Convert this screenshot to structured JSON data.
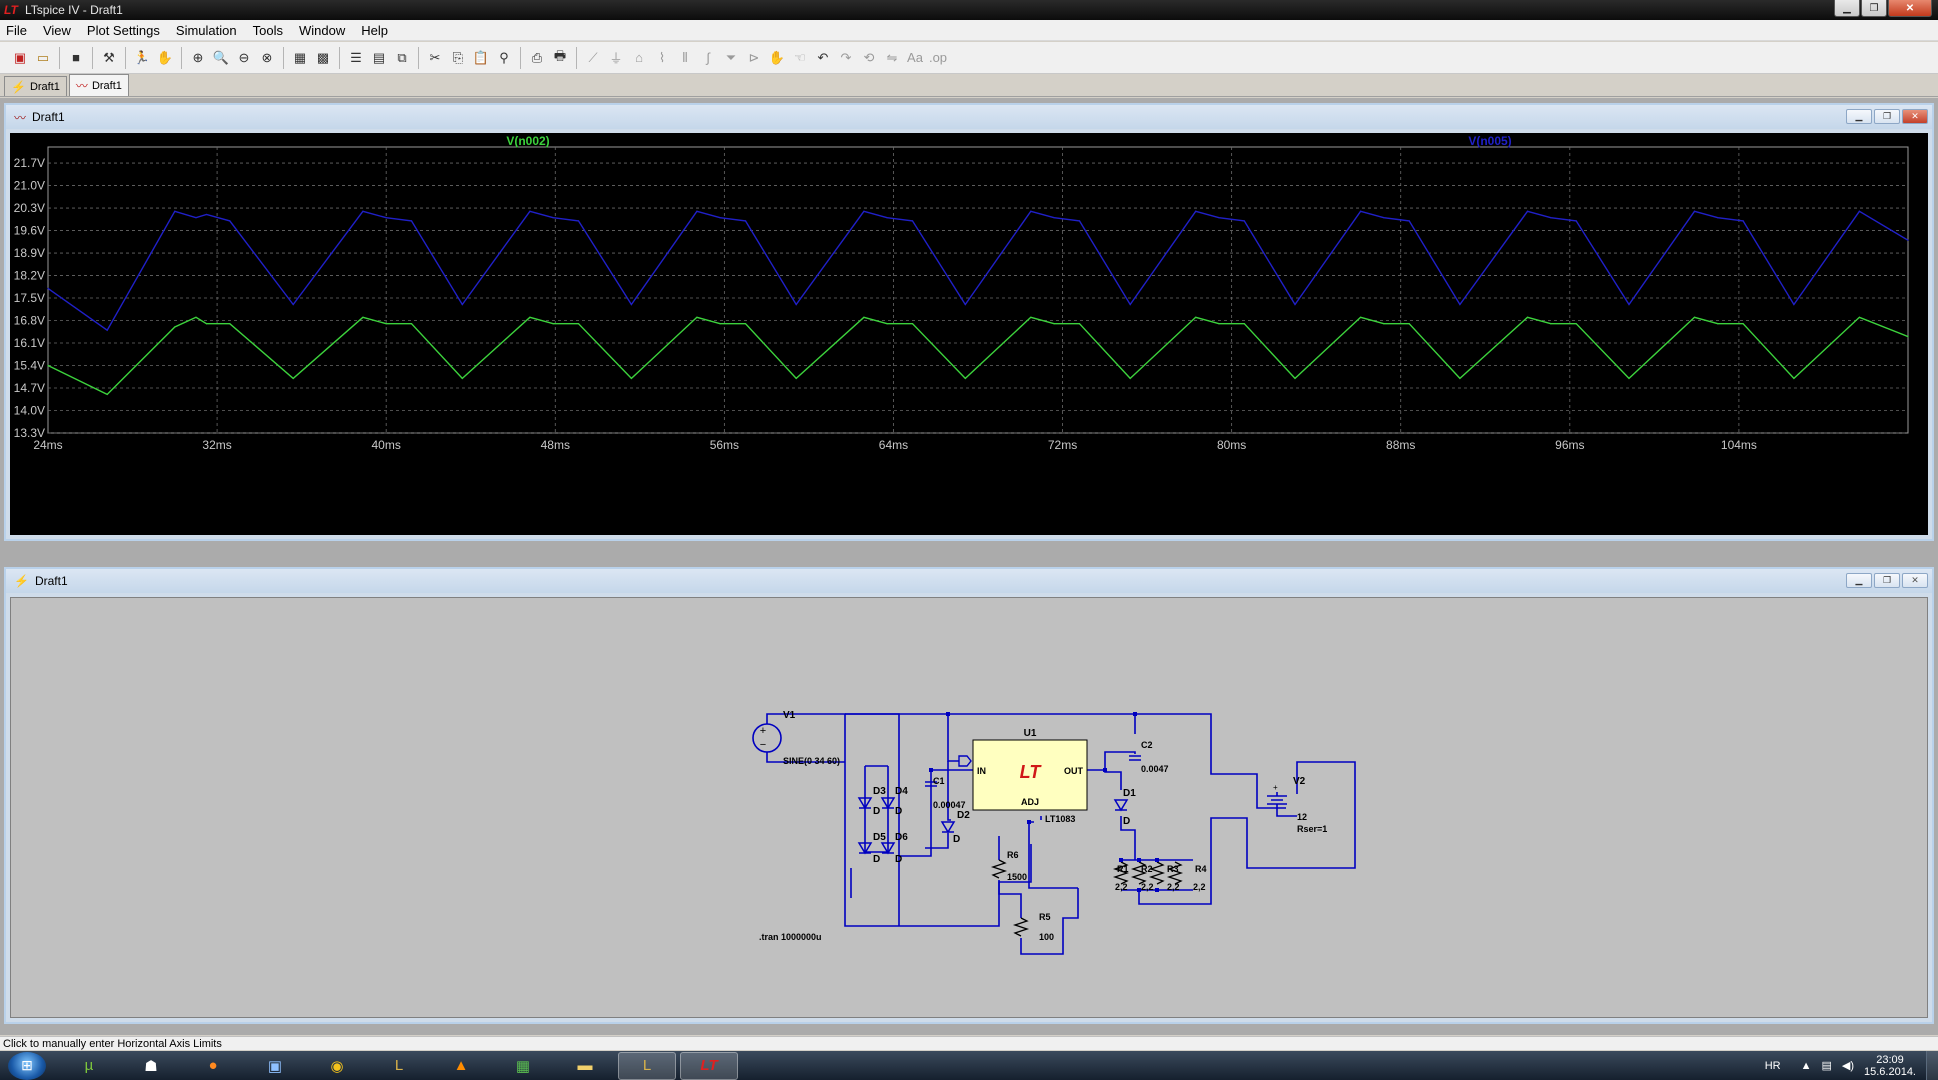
{
  "app": {
    "title": "LTspice IV - Draft1",
    "logo_text": "LT"
  },
  "menu": [
    "File",
    "View",
    "Plot Settings",
    "Simulation",
    "Tools",
    "Window",
    "Help"
  ],
  "toolbar": {
    "icons": [
      "new-schematic",
      "open",
      "save",
      "control-panel",
      "run",
      "pan",
      "zoom-in",
      "zoom-area",
      "zoom-out",
      "zoom-fit",
      "autorange",
      "mark-data",
      "tile-horizontal",
      "tile-vertical",
      "cascade",
      "cut",
      "copy",
      "paste",
      "find",
      "print-setup",
      "print",
      "draw-wire",
      "ground",
      "label-net",
      "resistor",
      "capacitor",
      "inductor",
      "diode",
      "component",
      "move",
      "drag",
      "undo",
      "redo",
      "rotate",
      "mirror",
      "text",
      "spice-directive"
    ]
  },
  "doc_tabs": [
    {
      "label": "Draft1",
      "icon": "schematic-icon"
    },
    {
      "label": "Draft1",
      "icon": "waveform-icon"
    }
  ],
  "waveform_window": {
    "title": "Draft1"
  },
  "schematic_window": {
    "title": "Draft1"
  },
  "chart_data": {
    "type": "line",
    "title": "",
    "xlabel": "",
    "ylabel": "",
    "x_unit": "ms",
    "y_unit": "V",
    "xlim": [
      24,
      112
    ],
    "ylim": [
      13.3,
      22.2
    ],
    "x_ticks": [
      "24ms",
      "32ms",
      "40ms",
      "48ms",
      "56ms",
      "64ms",
      "72ms",
      "80ms",
      "88ms",
      "96ms",
      "104ms"
    ],
    "y_ticks": [
      "21.7V",
      "21.0V",
      "20.3V",
      "19.6V",
      "18.9V",
      "18.2V",
      "17.5V",
      "16.8V",
      "16.1V",
      "15.4V",
      "14.7V",
      "14.0V",
      "13.3V"
    ],
    "grid": true,
    "background": "#000000",
    "series": [
      {
        "name": "V(n002)",
        "color": "#3cd23c",
        "label_position": "left",
        "x": [
          24,
          26.8,
          30.0,
          31.0,
          31.5,
          32.6,
          35.6,
          38.9,
          40.0,
          41.2,
          43.6,
          46.8,
          47.9,
          49.1,
          51.6,
          54.7,
          55.8,
          57.0,
          59.4,
          62.6,
          63.7,
          64.9,
          67.4,
          70.5,
          71.6,
          72.8,
          75.2,
          78.3,
          79.4,
          80.6,
          83.0,
          86.1,
          87.2,
          88.4,
          90.8,
          94.0,
          95.1,
          96.3,
          98.8,
          101.9,
          103.0,
          104.2,
          106.6,
          109.7,
          112
        ],
        "y": [
          15.4,
          14.5,
          16.6,
          16.9,
          16.7,
          16.7,
          15.0,
          16.9,
          16.7,
          16.7,
          15.0,
          16.9,
          16.7,
          16.7,
          15.0,
          16.9,
          16.7,
          16.7,
          15.0,
          16.9,
          16.7,
          16.7,
          15.0,
          16.9,
          16.7,
          16.7,
          15.0,
          16.9,
          16.7,
          16.7,
          15.0,
          16.9,
          16.7,
          16.7,
          15.0,
          16.9,
          16.7,
          16.7,
          15.0,
          16.9,
          16.7,
          16.7,
          15.0,
          16.9,
          16.3
        ]
      },
      {
        "name": "V(n005)",
        "color": "#2020c8",
        "label_position": "right",
        "x": [
          24,
          26.8,
          30.0,
          31.0,
          31.5,
          32.6,
          35.6,
          38.9,
          40.0,
          41.2,
          43.6,
          46.8,
          47.9,
          49.1,
          51.6,
          54.7,
          55.8,
          57.0,
          59.4,
          62.6,
          63.7,
          64.9,
          67.4,
          70.5,
          71.6,
          72.8,
          75.2,
          78.3,
          79.4,
          80.6,
          83.0,
          86.1,
          87.2,
          88.4,
          90.8,
          94.0,
          95.1,
          96.3,
          98.8,
          101.9,
          103.0,
          104.2,
          106.6,
          109.7,
          112
        ],
        "y": [
          17.8,
          16.5,
          20.2,
          20.0,
          20.1,
          19.9,
          17.3,
          20.2,
          20.0,
          19.9,
          17.3,
          20.2,
          20.0,
          19.9,
          17.3,
          20.2,
          20.0,
          19.9,
          17.3,
          20.2,
          20.0,
          19.9,
          17.3,
          20.2,
          20.0,
          19.9,
          17.3,
          20.2,
          20.0,
          19.9,
          17.3,
          20.2,
          20.0,
          19.9,
          17.3,
          20.2,
          20.0,
          19.9,
          17.3,
          20.2,
          20.0,
          19.9,
          17.3,
          20.2,
          19.3
        ]
      }
    ]
  },
  "schematic": {
    "wire_color": "#0000c0",
    "labels": {
      "v1": "V1",
      "v1_val": "SINE(0 34 60)",
      "u1": "U1",
      "u1_part": "LT1083",
      "pin_in": "IN",
      "pin_out": "OUT",
      "pin_adj": "ADJ",
      "c1": "C1",
      "c1_val": "0.00047",
      "c2": "C2",
      "c2_val": "0.0047",
      "d1": "D1",
      "d2": "D2",
      "d3": "D3",
      "d4": "D4",
      "d5": "D5",
      "d6": "D6",
      "d_model": "D",
      "r1": "R1",
      "r2": "R2",
      "r3": "R3",
      "r4": "R4",
      "r_val": "2,2",
      "r5": "R5",
      "r5_val": "100",
      "r6": "R6",
      "r6_val": "1500",
      "v2": "V2",
      "v2_val": "12",
      "v2_rser": "Rser=1",
      "directive": ".tran 1000000u"
    }
  },
  "status": {
    "text": "Click to manually enter Horizontal Axis Limits"
  },
  "taskbar": {
    "apps": [
      "utorrent",
      "mask-app",
      "firefox",
      "computer",
      "chrome",
      "league-of-legends",
      "vlc",
      "gpu-tool",
      "explorer",
      "league-of-legends-2",
      "ltspice"
    ],
    "lang": "HR",
    "time": "23:09",
    "date": "15.6.2014."
  }
}
